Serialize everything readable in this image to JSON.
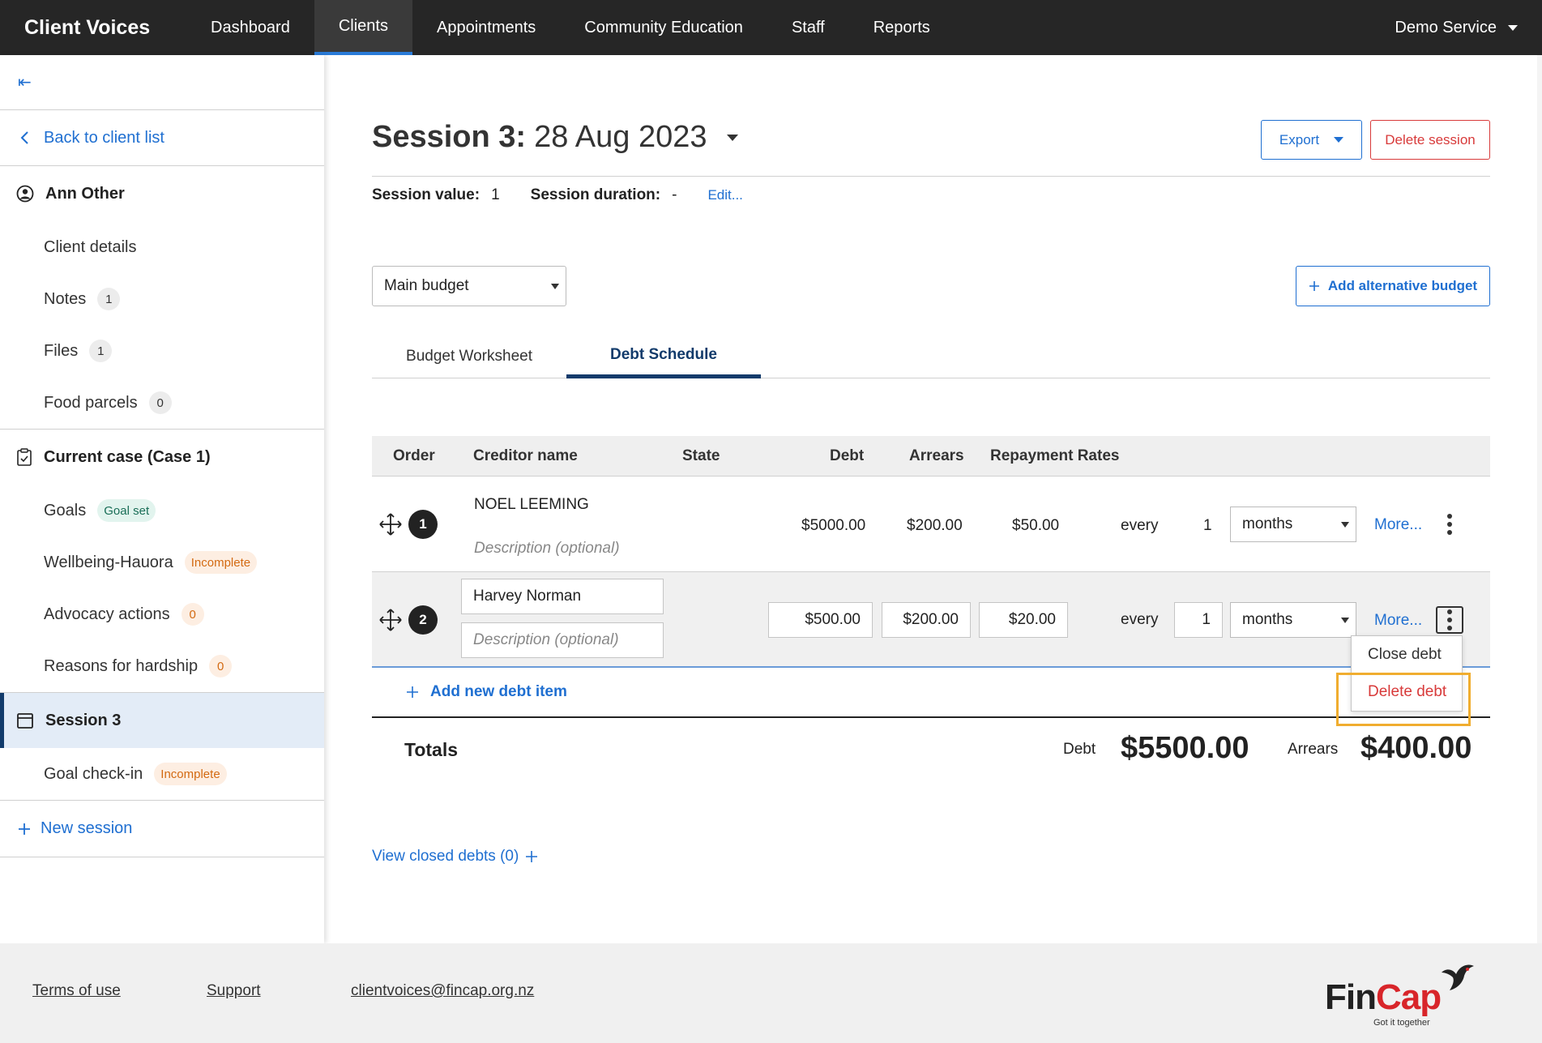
{
  "app": {
    "brand": "Client Voices",
    "nav": [
      "Dashboard",
      "Clients",
      "Appointments",
      "Community Education",
      "Staff",
      "Reports"
    ],
    "active_nav": "Clients",
    "account": "Demo Service"
  },
  "sidebar": {
    "collapse_icon": "⇤",
    "back": "Back to client list",
    "client": {
      "name": "Ann Other",
      "items": [
        {
          "label": "Client details",
          "badge": ""
        },
        {
          "label": "Notes",
          "badge": "1"
        },
        {
          "label": "Files",
          "badge": "1"
        },
        {
          "label": "Food parcels",
          "badge": "0"
        }
      ]
    },
    "case": {
      "title": "Current case (Case 1)",
      "items": [
        {
          "label": "Goals",
          "badge": "Goal set"
        },
        {
          "label": "Wellbeing-Hauora",
          "badge": "Incomplete"
        },
        {
          "label": "Advocacy actions",
          "badge": "0"
        },
        {
          "label": "Reasons for hardship",
          "badge": "0"
        }
      ]
    },
    "session": {
      "title": "Session 3",
      "items": [
        {
          "label": "Goal check-in",
          "badge": "Incomplete"
        }
      ]
    },
    "new_session": "New session"
  },
  "main": {
    "title_bold": "Session 3:",
    "title_date": "28 Aug 2023",
    "export_label": "Export",
    "delete_session_label": "Delete session",
    "session_value_label": "Session value:",
    "session_value": "1",
    "session_duration_label": "Session duration:",
    "session_duration": "-",
    "edit_label": "Edit...",
    "budget_select": "Main budget",
    "add_alt_budget": "Add alternative budget",
    "tabs": [
      "Budget Worksheet",
      "Debt Schedule"
    ],
    "active_tab": "Debt Schedule"
  },
  "debt_table": {
    "headers": [
      "Order",
      "Creditor name",
      "State",
      "Debt",
      "Arrears",
      "Repayment Rates"
    ],
    "rows": [
      {
        "order": "1",
        "creditor": "NOEL LEEMING",
        "description": "Description (optional)",
        "debt": "$5000.00",
        "arrears": "$200.00",
        "rate": "$50.00",
        "every": "every",
        "interval": "1",
        "period": "months",
        "more": "More..."
      },
      {
        "order": "2",
        "creditor": "Harvey Norman",
        "description": "Description (optional)",
        "debt": "$500.00",
        "arrears": "$200.00",
        "rate": "$20.00",
        "every": "every",
        "interval": "1",
        "period": "months",
        "more": "More..."
      }
    ],
    "add_item": "Add new debt item",
    "menu": [
      "Close debt",
      "Delete debt"
    ],
    "totals_label": "Totals",
    "total_debt_label": "Debt",
    "total_debt": "$5500.00",
    "total_arrears_label": "Arrears",
    "total_arrears": "$400.00"
  },
  "closed_debts": "View closed debts (0)",
  "footer": {
    "links": [
      "Terms of use",
      "Support",
      "clientvoices@fincap.org.nz"
    ],
    "logo_fin": "Fin",
    "logo_cap": "Cap",
    "logo_tag": "Got it together"
  },
  "colors": {
    "nav_bg": "#262626",
    "link": "#1f6fd1",
    "danger": "#d83a3a",
    "highlight": "#f0ad2f"
  }
}
